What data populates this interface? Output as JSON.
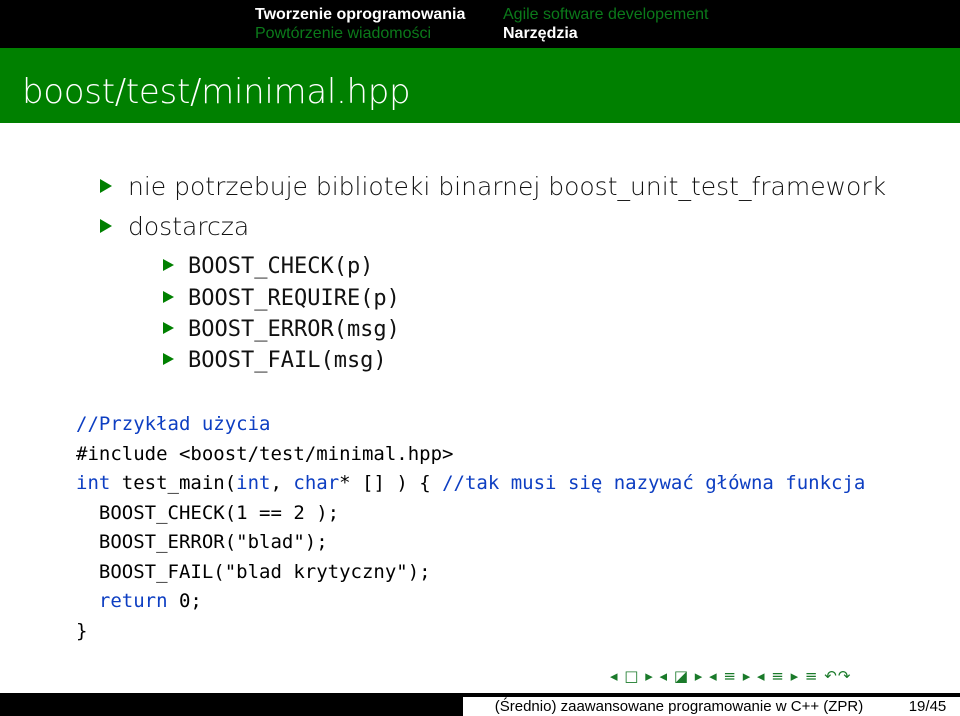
{
  "header": {
    "left": {
      "active": "Tworzenie oprogramowania",
      "inactive": "Powtórzenie wiadomości"
    },
    "right": {
      "inactive": "Agile software developement",
      "active": "Narzędzia"
    }
  },
  "slide": {
    "title": "boost/test/minimal.hpp",
    "bullets": [
      "nie potrzebuje biblioteki binarnej boost_unit_test_framework",
      "dostarcza"
    ],
    "subbullets": [
      "BOOST_CHECK(p)",
      "BOOST_REQUIRE(p)",
      "BOOST_ERROR(msg)",
      "BOOST_FAIL(msg)"
    ],
    "code": {
      "line1": "//Przykład użycia",
      "line2": "#include <boost/test/minimal.hpp>",
      "line3": {
        "kw1": "int",
        "t1": " test_main(",
        "kw2": "int",
        "t2": ", ",
        "kw3": "char",
        "t3": "* [] ) { ",
        "comment": "//tak musi się nazywać główna funkcja"
      },
      "line4": "  BOOST_CHECK(1 == 2 );",
      "line5": "  BOOST_ERROR(\"blad\");",
      "line6": "  BOOST_FAIL(\"blad krytyczny\");",
      "line7": {
        "indent": "  ",
        "kw": "return",
        "rest": " 0;"
      },
      "line8": "}"
    }
  },
  "navigation_symbols": "◂ □ ▸ ◂ ◪ ▸ ◂ ≡ ▸ ◂ ≡ ▸ ≡ ↶↷",
  "footer": {
    "title": "(Średnio) zaawansowane programowanie w C++ (ZPR)",
    "page": "19/45"
  },
  "colors": {
    "title_bg": "#008000",
    "nav_bg": "#000000",
    "code_keyword": "#0d3ec2",
    "bullet": "#008000"
  }
}
